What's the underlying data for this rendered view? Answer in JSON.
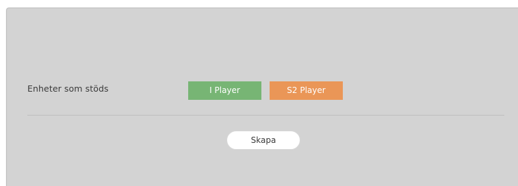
{
  "form": {
    "supported_devices_label": "Enheter som stöds",
    "devices": [
      {
        "label": "I Player",
        "color": "#77b574"
      },
      {
        "label": "S2 Player",
        "color": "#ea9657"
      }
    ],
    "create_label": "Skapa"
  },
  "colors": {
    "panel_background": "#d3d3d3",
    "divider": "#bfbfbf",
    "create_button_background": "#ffffff"
  }
}
